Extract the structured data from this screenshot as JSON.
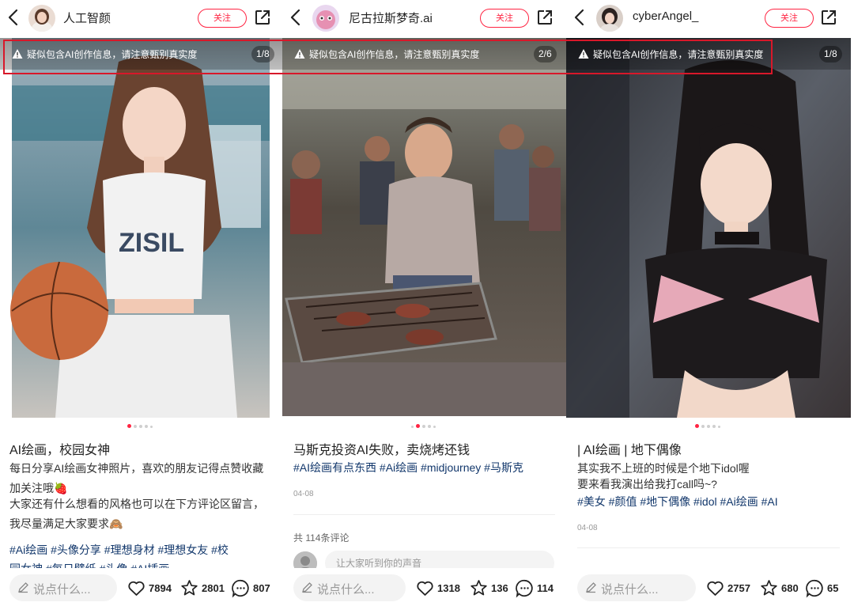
{
  "common": {
    "follow_label": "关注",
    "warning_text": "疑似包含AI创作信息，请注意甄别真实度",
    "say_placeholder": "说点什么...",
    "accent": "#ff2442"
  },
  "panels": [
    {
      "username": "人工智颜",
      "image_counter": "1/8",
      "title": "AI绘画，校园女神",
      "body_lines": [
        "每日分享AI绘画女神照片，喜欢的朋友记得点赞收藏",
        "加关注哦🍓",
        "大家还有什么想看的风格也可以在下方评论区留言，",
        "我尽量满足大家要求🙈"
      ],
      "tags_line1": "#Ai绘画 #头像分享 #理想身材 #理想女友 #校",
      "tags_line2": "园女神 #每日壁纸 #头像 #AI插画",
      "likes": "7894",
      "collects": "2801",
      "comments": "807"
    },
    {
      "username": "尼古拉斯梦奇.ai",
      "image_counter": "2/6",
      "title": "马斯克投资AI失败，卖烧烤还钱",
      "tags_line1": "#AI绘画有点东西 #Ai绘画 #midjourney #马斯克",
      "date": "04-08",
      "comment_count": "共 114条评论",
      "comment_placeholder": "让大家听到你的声音",
      "likes": "1318",
      "collects": "136",
      "comments": "114"
    },
    {
      "username": "cyberAngel_",
      "image_counter": "1/8",
      "title": "| AI绘画 | 地下偶像",
      "body_lines": [
        "其实我不上班的时候是个地下idol喔",
        "要来看我演出给我打call吗~?"
      ],
      "tags_line1": "#美女 #颜值 #地下偶像 #idol #Ai绘画 #AI",
      "date": "04-08",
      "likes": "2757",
      "collects": "680",
      "comments": "65"
    }
  ]
}
